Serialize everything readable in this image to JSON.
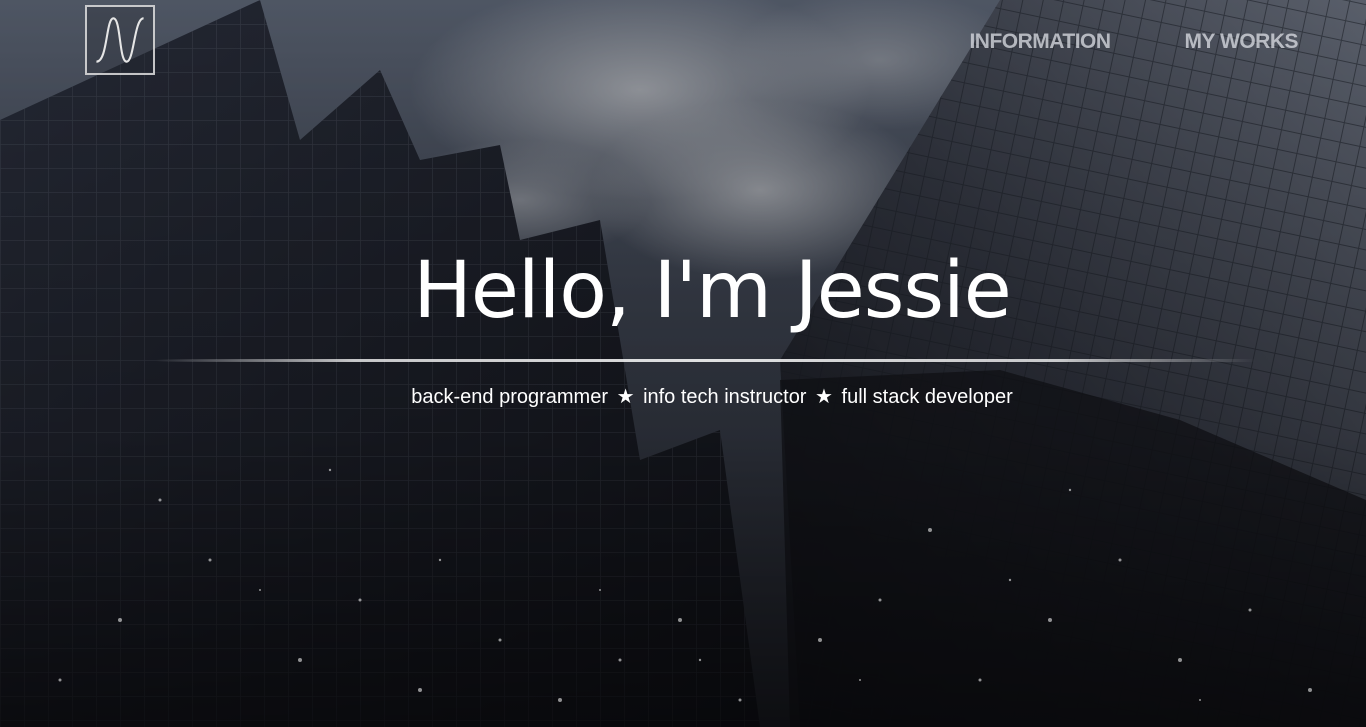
{
  "header": {
    "logo_icon": "waveform-logo-icon",
    "nav": [
      {
        "label": "INFORMATION"
      },
      {
        "label": "MY WORKS"
      }
    ]
  },
  "hero": {
    "headline": "Hello, I'm Jessie",
    "roles": [
      "back-end programmer",
      "info tech instructor",
      "full stack developer"
    ],
    "separator_icon": "star-icon"
  },
  "colors": {
    "text": "#ffffff",
    "nav_text": "#d7dae0",
    "overlay": "#1b1d22"
  }
}
